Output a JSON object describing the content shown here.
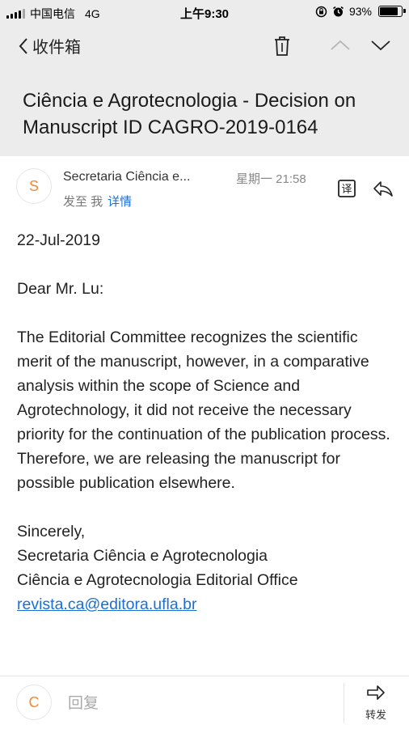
{
  "status_bar": {
    "carrier": "中国电信",
    "network": "4G",
    "time": "上午9:30",
    "battery_percent": "93%",
    "battery_level": 0.93
  },
  "nav": {
    "back_label": "收件箱"
  },
  "email": {
    "subject": "Ciência e Agrotecnologia - Decision on Manuscript ID CAGRO-2019-0164",
    "sender_initial": "S",
    "sender_name": "Secretaria Ciência e...",
    "time": "星期一 21:58",
    "to_prefix": "发至 我",
    "details_label": "详情",
    "body": {
      "date": "22-Jul-2019",
      "greeting": "Dear Mr. Lu:",
      "paragraph": "The Editorial Committee recognizes the scientific merit of the manuscript, however, in a comparative analysis within the scope of Science and Agrotechnology, it did not receive the necessary priority for the continuation of the publication process. Therefore, we are releasing the manuscript for possible publication elsewhere.",
      "closing": "Sincerely,",
      "signature_line1": "Secretaria Ciência e Agrotecnologia",
      "signature_line2": "Ciência e Agrotecnologia Editorial Office",
      "email": "revista.ca@editora.ufla.br"
    }
  },
  "bottom_bar": {
    "user_initial": "C",
    "reply_placeholder": "回复",
    "forward_label": "转发"
  },
  "colors": {
    "header_bg": "#ececec",
    "link": "#1a6fd6",
    "avatar_letter": "#f08a3a"
  }
}
